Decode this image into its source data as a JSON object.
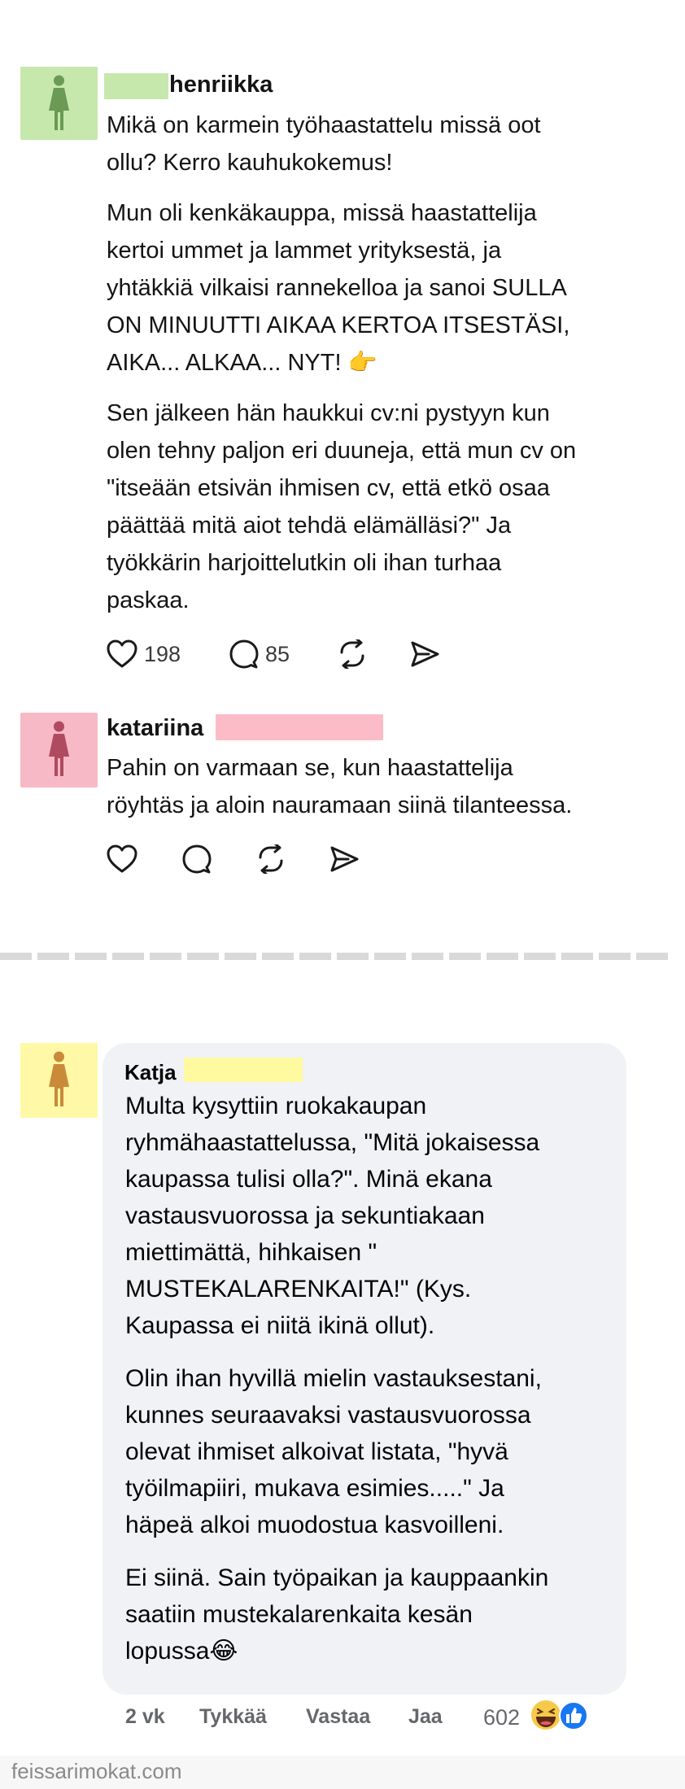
{
  "colors": {
    "green_avatar": "#c6e8ad",
    "green_figure": "#6a9a53",
    "pink_avatar": "#f7b9c5",
    "pink_figure": "#b04a5f",
    "yellow_avatar": "#fff8a6",
    "yellow_figure": "#c98a3a",
    "separator": "#d9d9d9",
    "bubble": "#f0f2f5",
    "like_blue": "#1877f2"
  },
  "thread_post_1": {
    "avatar_icon": "woman-figure-icon",
    "username": "henriikka",
    "paragraphs": [
      [
        "Mikä on karmein työhaastattelu missä oot",
        "ollu? Kerro kauhukokemus!"
      ],
      [
        "Mun oli kenkäkauppa, missä haastattelija",
        "kertoi ummet ja lammet yrityksestä, ja",
        "yhtäkkiä vilkaisi rannekelloa ja sanoi SULLA",
        "ON MINUUTTI AIKAA KERTOA ITSESTÄSI,",
        "AIKA... ALKAA... NYT! 👉"
      ],
      [
        "Sen jälkeen hän haukkui cv:ni pystyyn kun",
        "olen tehny paljon eri duuneja, että mun cv on",
        "\"itseään etsivän ihmisen cv, että etkö osaa",
        "päättää mitä aiot tehdä elämälläsi?\" Ja",
        "työkkärin harjoittelutkin oli ihan turhaa",
        "paskaa."
      ]
    ],
    "likes": "198",
    "comments": "85"
  },
  "thread_post_2": {
    "avatar_icon": "woman-figure-icon",
    "username": "katariina",
    "lines": [
      "Pahin on varmaan se, kun haastattelija",
      "röyhtäs ja aloin nauramaan siinä tilanteessa."
    ]
  },
  "fb_comment": {
    "avatar_icon": "woman-figure-icon",
    "username": "Katja",
    "paragraphs": [
      [
        "Multa kysyttiin ruokakaupan",
        "ryhmähaastattelussa, \"Mitä jokaisessa",
        "kaupassa tulisi olla?\". Minä ekana",
        "vastausvuorossa ja sekuntiakaan",
        "miettimättä, hihkaisen \"",
        "MUSTEKALARENKAITA!\" (Kys.",
        "Kaupassa ei niitä ikinä ollut)."
      ],
      [
        "Olin ihan hyvillä mielin vastauksestani,",
        "kunnes seuraavaksi vastausvuorossa",
        "olevat ihmiset alkoivat listata, \"hyvä",
        "työilmapiiri, mukava esimies.....\" Ja",
        "häpeä alkoi muodostua kasvoilleni."
      ],
      [
        "Ei siinä. Sain työpaikan ja kauppaankin",
        "saatiin mustekalarenkaita kesän",
        "lopussa😂"
      ]
    ],
    "time": "2 vk",
    "like_label": "Tykkää",
    "reply_label": "Vastaa",
    "share_label": "Jaa",
    "reaction_count": "602"
  },
  "watermark": "feissarimokat.com"
}
